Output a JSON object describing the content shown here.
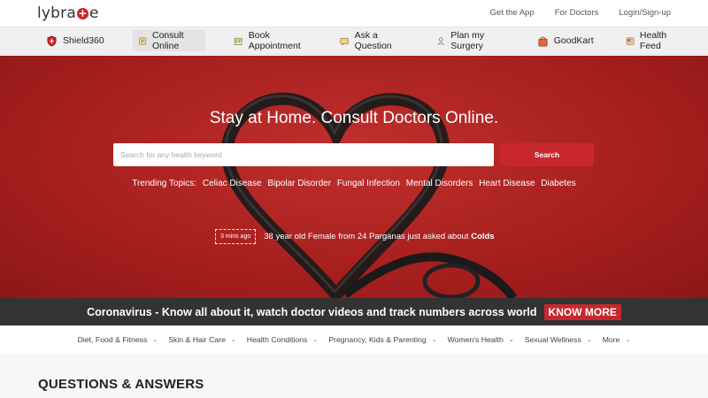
{
  "logo": {
    "part1": "lybra",
    "cross": "+",
    "part2": "e"
  },
  "top_links": [
    "Get the App",
    "For Doctors",
    "Login/Sign-up"
  ],
  "nav": [
    {
      "label": "Shield360",
      "icon": "shield-icon"
    },
    {
      "label": "Consult Online",
      "icon": "consult-icon"
    },
    {
      "label": "Book Appointment",
      "icon": "calendar-icon"
    },
    {
      "label": "Ask a Question",
      "icon": "chat-icon"
    },
    {
      "label": "Plan my Surgery",
      "icon": "surgeon-icon"
    },
    {
      "label": "GoodKart",
      "icon": "bag-icon"
    },
    {
      "label": "Health Feed",
      "icon": "feed-icon"
    }
  ],
  "hero": {
    "title": "Stay at Home. Consult Doctors Online.",
    "search_placeholder": "Search for any health keyword",
    "search_button": "Search",
    "trending_label": "Trending Topics:",
    "trending": [
      "Celiac Disease",
      "Bipolar Disorder",
      "Fungal Infection",
      "Mental Disorders",
      "Heart Disease",
      "Diabetes"
    ],
    "ticker_time": "3 mins ago",
    "ticker_text": "38 year old Female from 24 Parganas just asked about",
    "ticker_topic": "Colds"
  },
  "banner": {
    "text": "Coronavirus - Know all about it, watch doctor videos and track numbers across world",
    "button": "KNOW MORE"
  },
  "categories": [
    "Diet, Food & Fitness",
    "Skin & Hair Care",
    "Health Conditions",
    "Pregnancy, Kids & Parenting",
    "Women's Health",
    "Sexual Wellness",
    "More"
  ],
  "qa_title": "QUESTIONS & ANSWERS",
  "colors": {
    "brand_red": "#c8272d",
    "banner_dark": "#333333",
    "nav_bg": "#f0f0f0"
  }
}
